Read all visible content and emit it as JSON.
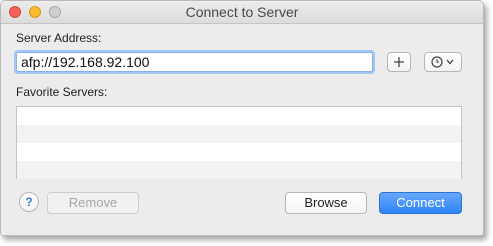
{
  "window": {
    "title": "Connect to Server"
  },
  "server": {
    "label": "Server Address:",
    "value": "afp://192.168.92.100",
    "add_icon": "plus-icon",
    "recent_icon": "clock-icon"
  },
  "favorites": {
    "label": "Favorite Servers:",
    "items": []
  },
  "buttons": {
    "help": "?",
    "remove": "Remove",
    "browse": "Browse",
    "connect": "Connect"
  },
  "colors": {
    "accent": "#2f84f6",
    "focus_ring": "#a3c6f5"
  }
}
